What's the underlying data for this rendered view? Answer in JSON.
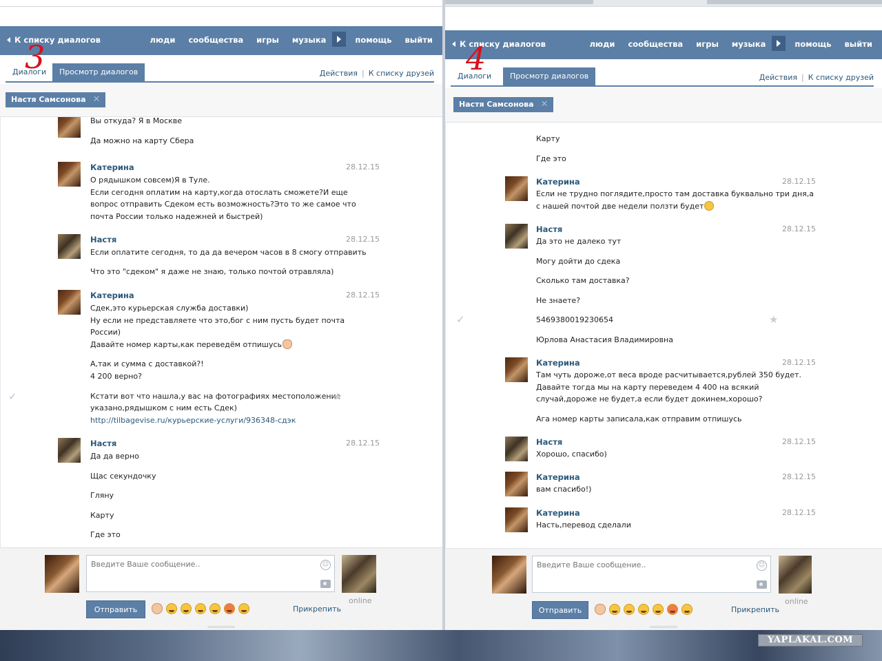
{
  "common": {
    "back_label": "К списку диалогов",
    "nav_links": [
      "люди",
      "сообщества",
      "игры",
      "музыка",
      "помощь",
      "выйти"
    ],
    "tab_dialogs": "Диалоги",
    "tab_view": "Просмотр диалогов",
    "actions": "Действия",
    "actions_sep": "|",
    "friends": "К списку друзей",
    "chip_name": "Настя Самсонова",
    "chip_close": "✕",
    "placeholder": "Введите Ваше сообщение..",
    "send_label": "Отправить",
    "attach_label": "Прикрепить",
    "online_label": "online",
    "check": "✓",
    "star": "★",
    "watermark": "YAPLAKAL.COM"
  },
  "panel3": {
    "overlay_number": "3",
    "messages": [
      {
        "author": "",
        "date": "",
        "lines": [
          "Вы откуда? Я в Москве",
          "Да можно на карту Сбера"
        ]
      },
      {
        "author": "Катерина",
        "date": "28.12.15",
        "lines": [
          "О рядышком совсем)Я в Туле.",
          "Если сегодня оплатим на карту,когда отослать сможете?И еще",
          "вопрос отправить Сдеком есть возможность?Это то же самое что",
          "почта России только надежней и быстрей)"
        ]
      },
      {
        "author": "Настя",
        "date": "28.12.15",
        "lines": [
          "Если оплатите сегодня, то да да вечером часов в 8 смогу отправить",
          "Что это \"сдеком\" я даже не знаю, только почтой отравляла)"
        ]
      },
      {
        "author": "Катерина",
        "date": "28.12.15",
        "lines": [
          "Сдек,это курьерская служба доставки)",
          "Ну если не представляете что это,бог с ним пусть будет почта",
          "России)",
          "Давайте номер карты,как переведём отпишусь",
          "А,так и сумма с доставкой?!",
          "4 200 верно?",
          "Кстати вот что нашла,у вас на фотографиях местоположение",
          "указано,рядышком с ним есть Сдек)",
          "http://tilbagevise.ru/курьерские-услуги/936348-сдэк"
        ]
      },
      {
        "author": "Настя",
        "date": "28.12.15",
        "lines": [
          "Да да верно",
          "Щас секундочку",
          "Гляну",
          "Карту",
          "Где это"
        ]
      }
    ]
  },
  "panel4": {
    "overlay_number": "4",
    "messages": [
      {
        "author": "",
        "date": "",
        "lines": [
          "Карту",
          "Где это"
        ]
      },
      {
        "author": "Катерина",
        "date": "28.12.15",
        "lines": [
          "Если не трудно поглядите,просто там доставка буквально три дня,а",
          "с нашей почтой две недели ползти будет"
        ]
      },
      {
        "author": "Настя",
        "date": "28.12.15",
        "lines": [
          "Да это не далеко тут",
          "Могу дойти до сдека",
          "Сколько там доставка?",
          "Не знаете?",
          "5469380019230654",
          "Юрлова Анастасия Владимировна"
        ]
      },
      {
        "author": "Катерина",
        "date": "28.12.15",
        "lines": [
          "Там чуть дороже,от веса вроде расчитывается,рублей 350 будет.",
          "Давайте тогда мы на карту переведем 4 400 на всякий",
          "случай,дороже не будет,а если будет докинем,хорошо?",
          "Ага номер карты записала,как отправим отпишусь"
        ]
      },
      {
        "author": "Настя",
        "date": "28.12.15",
        "lines": [
          "Хорошо, спасибо)"
        ]
      },
      {
        "author": "Катерина",
        "date": "28.12.15",
        "lines": [
          "вам спасибо!)"
        ]
      },
      {
        "author": "Катерина",
        "date": "28.12.15",
        "lines": [
          "Насть,перевод сделали"
        ]
      }
    ]
  }
}
